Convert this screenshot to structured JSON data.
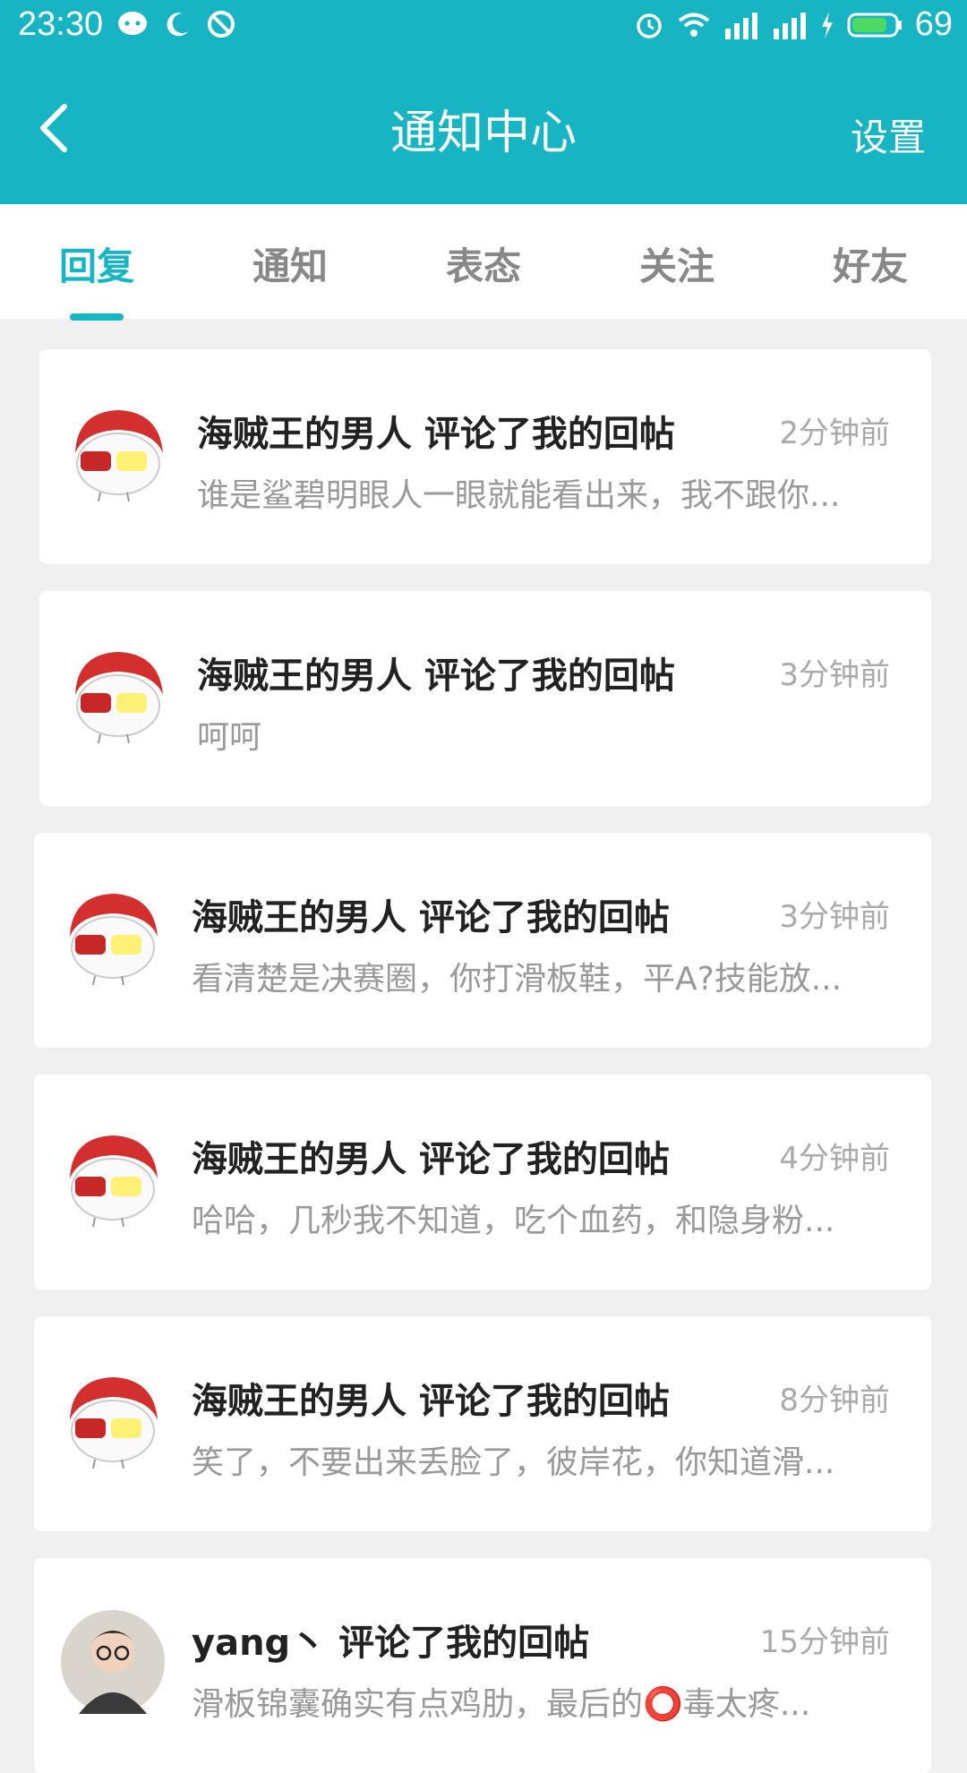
{
  "status_bar": {
    "time": "23:30",
    "battery_level": "69",
    "icons": [
      "chat-bubble-icon",
      "moon-icon",
      "do-not-disturb-icon",
      "alarm-icon",
      "wifi-icon",
      "signal-4g-icon",
      "signal-icon",
      "charging-icon",
      "battery-icon"
    ]
  },
  "header": {
    "back_icon": "chevron-left-icon",
    "title": "通知中心",
    "settings_label": "设置"
  },
  "tabs": [
    {
      "label": "回复",
      "active": true
    },
    {
      "label": "通知",
      "active": false
    },
    {
      "label": "表态",
      "active": false
    },
    {
      "label": "关注",
      "active": false
    },
    {
      "label": "好友",
      "active": false
    }
  ],
  "colors": {
    "accent": "#17b5c4",
    "title_text": "#222222",
    "muted_text": "#999999",
    "background": "#f0f0f0"
  },
  "notifications": [
    {
      "title": "海贼王的男人 评论了我的回帖",
      "time": "2分钟前",
      "preview": "谁是鲨碧明眼人一眼就能看出来，我不跟你...",
      "avatar": "cartoon-avatar"
    },
    {
      "title": "海贼王的男人 评论了我的回帖",
      "time": "3分钟前",
      "preview": "呵呵",
      "avatar": "cartoon-avatar"
    },
    {
      "title": "海贼王的男人 评论了我的回帖",
      "time": "3分钟前",
      "preview": "看清楚是决赛圈，你打滑板鞋，平A?技能放...",
      "avatar": "cartoon-avatar"
    },
    {
      "title": "海贼王的男人 评论了我的回帖",
      "time": "4分钟前",
      "preview": "哈哈，几秒我不知道，吃个血药，和隐身粉...",
      "avatar": "cartoon-avatar"
    },
    {
      "title": "海贼王的男人 评论了我的回帖",
      "time": "8分钟前",
      "preview": "笑了，不要出来丢脸了，彼岸花，你知道滑...",
      "avatar": "cartoon-avatar"
    },
    {
      "title": "yang丶 评论了我的回帖",
      "time": "15分钟前",
      "preview": "滑板锦囊确实有点鸡肋，最后的⭕毒太疼...",
      "avatar": "photo-avatar"
    }
  ]
}
